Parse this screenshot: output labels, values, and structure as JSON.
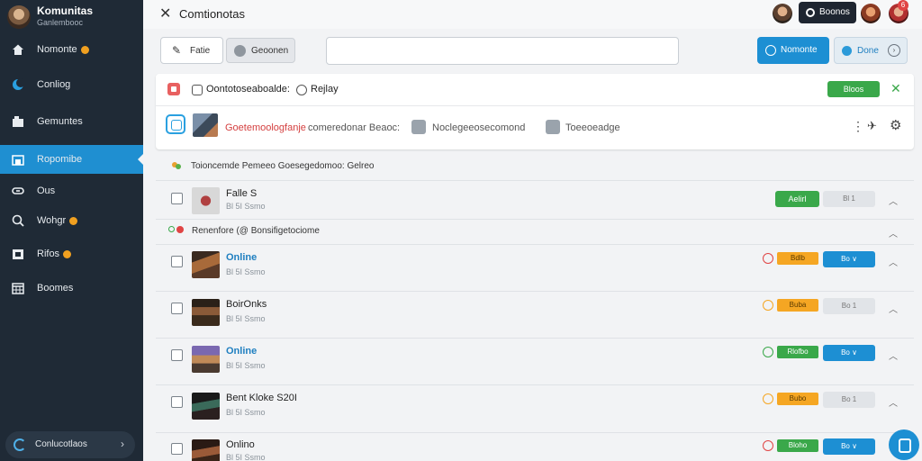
{
  "sidebar": {
    "title": "Komunitas",
    "subtitle": "Ganlembooc",
    "items": [
      {
        "label": "Nomonte",
        "icon": "home-icon",
        "badge": true
      },
      {
        "label": "Conliog",
        "icon": "moon-icon",
        "badge": false
      },
      {
        "label": "Gemuntes",
        "icon": "building-icon",
        "badge": false
      },
      {
        "label": "Ropomibe",
        "icon": "store-icon",
        "badge": false,
        "active": true
      },
      {
        "label": "Ous",
        "icon": "link-icon",
        "badge": false
      },
      {
        "label": "Wohgr",
        "icon": "search-icon",
        "badge": true
      },
      {
        "label": "Rifos",
        "icon": "folder-icon",
        "badge": true
      },
      {
        "label": "Boomes",
        "icon": "calendar-icon",
        "badge": false
      }
    ],
    "footer_label": "Conlucotlaos"
  },
  "topbar": {
    "title": "Comtionotas",
    "pill_label": "Boonos",
    "notif_count": "6"
  },
  "toolbar": {
    "edit_label": "Fatie",
    "secondary_label": "Geoonen",
    "search_value": "",
    "primary_label": "Nomonte",
    "done_label": "Done"
  },
  "card": {
    "row1_text": "Oontotoseaboalde:",
    "row1_text2": "Rejlay",
    "row1_button": "Bloos",
    "row2_red": "Goetemoologfanje",
    "row2_grey": "comeredonar Beaoc:",
    "row2_grey2": "Noclegeeosecomond",
    "row2_grey3": "Toeeoeadge"
  },
  "section1": "Toioncemde Pemeeo Goesegedomoo: Gelreo",
  "section2": "Renenfore (@ Bonsifigetociome",
  "rows": [
    {
      "title": "Falle S",
      "meta": "Bl 5I Ssmo",
      "status": "Aelirl",
      "status_color": "#3aa84a",
      "action": "Bl 1",
      "action_style": "grey",
      "online": false,
      "dot_color": ""
    },
    {
      "title": "Online",
      "meta": "Bl 5I Ssmo",
      "status": "Bdlb",
      "status_color": "#f5a623",
      "action": "Bo ∨",
      "action_style": "blue",
      "online": true,
      "dot_color": "#e04444"
    },
    {
      "title": "BoirOnks",
      "meta": "Bl 5I Ssmo",
      "status": "Buba",
      "status_color": "#f5a623",
      "action": "Bo 1",
      "action_style": "grey",
      "online": false,
      "dot_color": "#f5a623"
    },
    {
      "title": "Online",
      "meta": "Bl 5I Ssmo",
      "status": "Rlofbo",
      "status_color": "#3aa84a",
      "action": "Bo ∨",
      "action_style": "blue",
      "online": true,
      "dot_color": "#3aa84a"
    },
    {
      "title": "Bent Kloke S20I",
      "meta": "Bl 5I Ssmo",
      "status": "Bubo",
      "status_color": "#f5a623",
      "action": "Bo 1",
      "action_style": "grey",
      "online": false,
      "dot_color": "#f5a623"
    },
    {
      "title": "Onlino",
      "meta": "Bl 5I Ssmo",
      "status": "Bloho",
      "status_color": "#3aa84a",
      "action": "Bo ∨",
      "action_style": "blue",
      "online": false,
      "dot_color": "#e04444"
    }
  ]
}
